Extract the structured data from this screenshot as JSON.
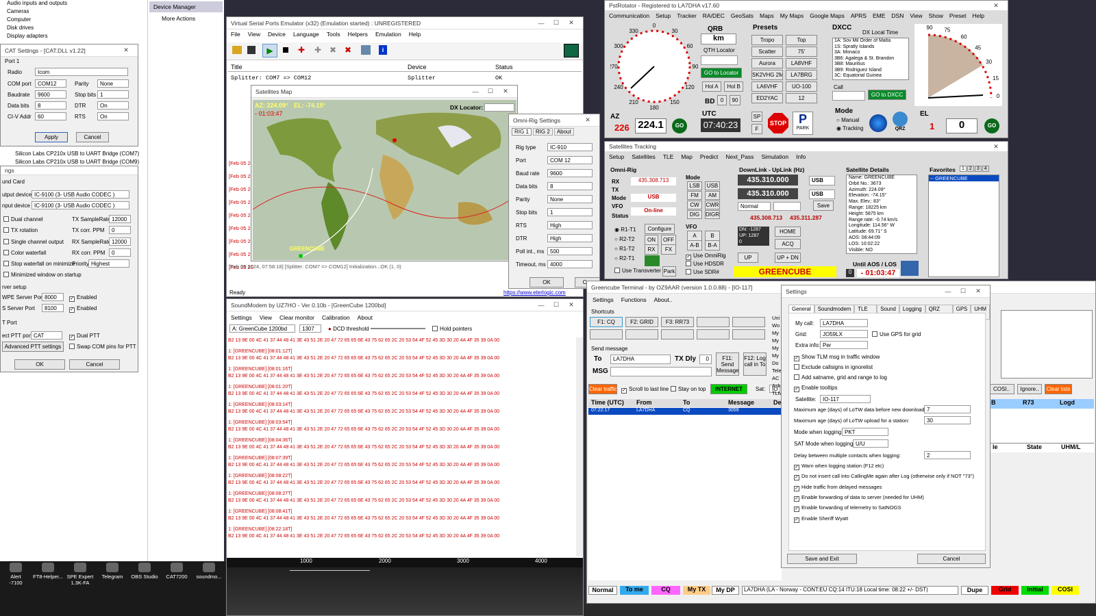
{
  "devmgr": {
    "items": [
      "Audio inputs and outputs",
      "Cameras",
      "Computer",
      "Disk drives",
      "Display adapters"
    ],
    "usb1": "Silicon Labs CP210x USB to UART Bridge (COM7)",
    "usb2": "Silicon Labs CP210x USB to UART Bridge (COM9)",
    "panel_title": "Device Manager",
    "more_actions": "More Actions"
  },
  "cat": {
    "title": "CAT Settings - [CAT.DLL v1.22]",
    "group": "Port 1",
    "radio_lbl": "Radio",
    "radio": "Icom",
    "com_lbl": "COM port",
    "com": "COM12",
    "parity_lbl": "Parity",
    "parity": "None",
    "baud_lbl": "Baudrate",
    "baud": "9600",
    "stop_lbl": "Stop bits",
    "stop": "1",
    "data_lbl": "Data bits",
    "data": "8",
    "dtr_lbl": "DTR",
    "dtr": "On",
    "civ_lbl": "CI-V Addr",
    "civ": "60",
    "rts_lbl": "RTS",
    "rts": "On",
    "apply": "Apply",
    "cancel": "Cancel"
  },
  "ss": {
    "title": "ngs",
    "group": "und Card",
    "out_lbl": "utput device",
    "out": "IC-9100 (3- USB Audio CODEC )",
    "in_lbl": "nput device",
    "in": "IC-9100 (3- USB Audio CODEC )",
    "dual": "Dual channel",
    "txsr_lbl": "TX SampleRate",
    "txsr": "12000",
    "txrot": "TX rotation",
    "txppm_lbl": "TX corr. PPM",
    "txppm": "0",
    "single": "Single channel output",
    "rxsr_lbl": "RX SampleRate",
    "rxsr": "12000",
    "color": "Color waterfall",
    "rxppm_lbl": "RX corr. PPM",
    "rxppm": "0",
    "stopwf": "Stop waterfall on minimize",
    "prio_lbl": "Priority",
    "prio": "Highest",
    "minwin": "Minimized window on startup",
    "srv": "rver setup",
    "agwpe_lbl": "WPE Server Port",
    "agwpe": "8000",
    "kiss_lbl": "S Server Port",
    "kiss": "8100",
    "enabled": "Enabled",
    "ptt": "T Port",
    "pttport_lbl": "ect PTT port",
    "pttport": "CAT",
    "dualptt": "Dual PTT",
    "swap": "Swap COM pins for PTT",
    "adv": "Advanced PTT settings",
    "ok": "OK",
    "cancel": "Cancel"
  },
  "vspe": {
    "title": "Virtual Serial Ports Emulator (x32) (Emulation started) : UNREGISTERED",
    "menu": [
      "File",
      "View",
      "Device",
      "Language",
      "Tools",
      "Helpers",
      "Emulation",
      "Help"
    ],
    "cols": [
      "Title",
      "Device",
      "Status"
    ],
    "row": {
      "title": "Splitter: COM7 => COM12",
      "device": "Splitter",
      "status": "OK"
    },
    "log": "[Feb 05 2024, 07:58:18] [Splitter: COM7 => COM12] Initialization...OK (1, 0)",
    "ready": "Ready",
    "link": "https://www.eterlogic.com",
    "dates": [
      "[Feb 05 20",
      "[Feb 05 20",
      "[Feb 05 20",
      "[Feb 05 20",
      "[Feb 05 20",
      "[Feb 05 20",
      "[Feb 05 20",
      "[Feb 05 20",
      "[Feb 05 20"
    ]
  },
  "satmap": {
    "title": "Satellites Map",
    "az": "AZ: 224.09°",
    "el": "EL: -74.15°",
    "time": "- 01:03:47",
    "dx": "DX Locator:",
    "sat": "GREENCUBE"
  },
  "omni": {
    "title": "Omni-Rig Settings",
    "tabs": [
      "RIG 1",
      "RIG 2",
      "About"
    ],
    "fields": [
      {
        "l": "Rig type",
        "v": "IC-910"
      },
      {
        "l": "Port",
        "v": "COM 12"
      },
      {
        "l": "Baud rate",
        "v": "9600"
      },
      {
        "l": "Data bits",
        "v": "8"
      },
      {
        "l": "Parity",
        "v": "None"
      },
      {
        "l": "Stop bits",
        "v": "1"
      },
      {
        "l": "RTS",
        "v": "High"
      },
      {
        "l": "DTR",
        "v": "High"
      },
      {
        "l": "Poll int., ms",
        "v": "500"
      },
      {
        "l": "Timeout, ms",
        "v": "4000"
      }
    ],
    "ok": "OK",
    "cancel": "Can"
  },
  "sm": {
    "title": "SoundModem by UZ7HO - Ver 0.10b - [GreenCube 1200bd]",
    "menu": [
      "Settings",
      "View",
      "Clear monitor",
      "Calibration",
      "About"
    ],
    "mode": "A: GreenCube 1200bd",
    "freq": "1307",
    "dcd": "DCD threshold",
    "hold": "Hold pointers",
    "hex": "B2 13 9E 00 4C 41 37 44 48 41 3E 43 51 2E 20 47 72 65 65 6E 43 75 62 65 2C 20 53 54 4F 52 45 3D 30 20 4A 4F 35 39 0A 00",
    "frames": [
      "1: [GREENCUBE] [08:01:12T]",
      "1: [GREENCUBE] [08:01:16T]",
      "1: [GREENCUBE] [08:01:20T]",
      "1: [GREENCUBE] [08:03:14T]",
      "1: [GREENCUBE] [08:03:54T]",
      "1: [GREENCUBE] [08:04:36T]",
      "1: [GREENCUBE] [08:07:39T]",
      "1: [GREENCUBE] [08:08:22T]",
      "1: [GREENCUBE] [08:08:27T]",
      "1: [GREENCUBE] [08:08:41T]",
      "1: [GREENCUBE] [08:22:18T]"
    ],
    "ticks": [
      "1000",
      "2000",
      "3000",
      "4000"
    ]
  },
  "pst": {
    "title": "PstRotator - Registered to LA7DHA  v17.60",
    "menu": [
      "Communication",
      "Setup",
      "Tracker",
      "RA/DEC",
      "GeoSats",
      "Maps",
      "My Maps",
      "Google Maps",
      "APRS",
      "EME",
      "DSN",
      "View",
      "Show",
      "Preset",
      "Help"
    ],
    "az_lbl": "AZ",
    "az_set": "226",
    "az": "224.1",
    "el_lbl": "EL",
    "el_set": "1",
    "el": "0",
    "go": "GO",
    "qrb": "QRB",
    "km": "km",
    "qthloc": "QTH Locator",
    "golocator": "GO to Locator",
    "hola": "Hol A",
    "holb": "Hol B",
    "bd": "BD",
    "bd0": "0",
    "bd90": "90",
    "utc_lbl": "UTC",
    "utc": "07:40:23",
    "presets": "Presets",
    "preset_btns": [
      "Tropo",
      "Top",
      "Scatter",
      "75'",
      "Aurora",
      "LA8VHF",
      "SK2VHG 2M",
      "LA7BRG",
      "LA6VHF",
      "UO-100",
      "ED2YAC",
      "12"
    ],
    "dxcc": "DXCC",
    "dxtime": "DX Local Time",
    "dxlist": [
      "1A:  Sov Mil Order of Malta",
      "1S:  Spratly Islands",
      "3A:  Monaco",
      "3B6:  Agalega & St. Brandon",
      "3B8:  Mauritius",
      "3B9:  Rodriguez Island",
      "3C:  Equatorial Guinea"
    ],
    "call": "Call",
    "godxcc": "GO to DXCC",
    "mode": "Mode",
    "manual": "Manual",
    "tracking": "Tracking",
    "stop": "STOP",
    "park": "PARK",
    "qrz": "QRZ",
    "sp": "SP",
    "f": "F",
    "dial": [
      "0",
      "30",
      "60",
      "90",
      "120",
      "150",
      "180",
      "210",
      "240",
      "270",
      "300",
      "330"
    ],
    "eldial": [
      "90",
      "75",
      "60",
      "45",
      "30",
      "15",
      "0"
    ]
  },
  "track": {
    "title": "Satellites Tracking",
    "menu": [
      "Setup",
      "Satellites",
      "TLE",
      "Map",
      "Predict",
      "Next_Pass",
      "Simulation",
      "Info"
    ],
    "omni": "Omni-Rig",
    "rx_lbl": "RX",
    "rx": "435.308.713",
    "tx_lbl": "TX",
    "mode_lbl": "Mode",
    "mode": "USB",
    "vfo_lbl": "VFO",
    "status_lbl": "Status",
    "status": "On-line",
    "rigs": [
      "R1-T1",
      "R2-T2",
      "R1-T2",
      "R2-T1"
    ],
    "modes_lbl": "Mode",
    "modes": [
      "LSB",
      "USB",
      "FM",
      "AM",
      "CW",
      "CWR",
      "DIG",
      "DIGR"
    ],
    "configure": "Configure",
    "on": "ON",
    "off": "OFF",
    "rxb": "RX",
    "txb": "TX",
    "fx": "FX",
    "vfo": "VFO",
    "vfoa": "A",
    "vfob": "B",
    "ab": "A-B",
    "ba": "B-A",
    "omnirig": "Use OmniRig",
    "hdsdr": "Use HDSDR",
    "sdr": "Use SDR#",
    "transv": "Use Transverter",
    "park": "Park",
    "dl": "DownLink - UpLink (Hz)",
    "f1": "435.310.000",
    "f2": "435.310.000",
    "usb": "USB",
    "normal": "Normal",
    "save": "Save",
    "dn": "DN: -1287",
    "up": "UP: 1287",
    "zero": "0",
    "fd1": "435.308.713",
    "fd2": "435.311.287",
    "home": "HOME",
    "acq": "ACQ",
    "upb": "UP",
    "updn": "UP + DN",
    "satname": "GREENCUBE",
    "details_lbl": "Satellite Details",
    "details": [
      "Name: GREENCUBE",
      "Orbit No.: 3673",
      "Azimuth: 224.09°",
      "Elevation: -74.15°",
      "Max. Elev.: 83°",
      "Range: 18225 km",
      "Height: 5875 km",
      "Range rate: -0.74 km/s",
      "Longitude: 114.56° W",
      "Latitude: 69.71° S",
      "AOS: 08:44:09",
      "LOS: 10:02:22",
      "Visible: NO"
    ],
    "aos": "Until AOS / LOS",
    "aosn": "0",
    "countdown": "- 01:03:47",
    "fav": "Favorites",
    "favtabs": [
      "1",
      "2",
      "3",
      "4"
    ],
    "favsel": "-- GREENCUBE"
  },
  "gt": {
    "title": "Greencube Terminal - by OZ9AAR (version 1.0.0.88) - [IO-117]",
    "menu": [
      "Settings",
      "Functions",
      "About.."
    ],
    "shortcuts": "Shortcuts",
    "sc": [
      "F1: CQ",
      "F2: GRID",
      "F3: RR73"
    ],
    "send": "Send message",
    "to_lbl": "To",
    "to": "LA7DHA",
    "txdly": "TX Dly",
    "txdlyv": "0",
    "msg_lbl": "MSG",
    "f11": "F11: Send Message",
    "f12": "F12: Log call in To",
    "clear": "Clear traffic",
    "scroll": "Scroll to last line",
    "top": "Stay on top",
    "internet": "INTERNET",
    "sat": "Sat:",
    "sat_v": "IO",
    "cols": [
      "Time (UTC)",
      "From",
      "To",
      "Message",
      "De"
    ],
    "row": [
      "07:22:17",
      "LA7DHA",
      "CQ",
      "3059",
      ""
    ],
    "side": [
      "Uni",
      "Wo",
      "My",
      "My",
      "My",
      "My",
      "Do",
      "Tele",
      "AC",
      "Ask",
      "TLM"
    ],
    "bottom": [
      "Normal",
      "To me",
      "CQ",
      "My TX",
      "My DP"
    ],
    "status": "LA7DHA (LA - Norway - CONT:EU CQ:14 ITU:18 Local time: 08:22 +/- DST)",
    "dupe": "Dupe",
    "grid": "Grid",
    "initial": "Initial",
    "cosi": "COSI",
    "right": [
      "COSI..",
      "Ignore..",
      "Clear lists"
    ],
    "rcols": [
      "B",
      "R73",
      "Logd"
    ],
    "rcols2": [
      "le",
      "State",
      "UHM/L"
    ]
  },
  "gs": {
    "title": "Settings",
    "tabs": [
      "General",
      "Soundmodem",
      "TLE data",
      "Sound",
      "Logging",
      "QRZ lookup",
      "GPS",
      "UHM"
    ],
    "mycall_lbl": "My call:",
    "mycall": "LA7DHA",
    "grid_lbl": "Grid:",
    "grid": "JO59LX",
    "gps": "Use GPS for grid",
    "extra_lbl": "Extra info:",
    "extra": "Per",
    "checks1": [
      "Show TLM msg in traffic window",
      "Exclude callsigns in ignorelist",
      "Add satname, grid and range to log",
      "Enable tooltips"
    ],
    "sat_lbl": "Satellite:",
    "sat": "IO-117",
    "lotw1": "Maximum age (days) of LoTW data before new download:",
    "lotw1v": "7",
    "lotw2": "Maximum age (days) of LoTW upload for a station:",
    "lotw2v": "30",
    "mode_lbl": "Mode when logging:",
    "mode": "PKT",
    "satmode_lbl": "SAT Mode when logging:",
    "satmode": "U/U",
    "delay_lbl": "Delay between multiple contacts when logging:",
    "delay": "2",
    "checks2": [
      "Warn when logging station (F12 etc)",
      "Do not insert call into CallingMe again after Log (otherwise only if NOT \"73\")",
      "Hide traffic from delayed messages",
      "Enable forwarding of data to server (needed for UHM)",
      "Enable forwarding of telemetry to SatNOGS",
      "Enable Sheriff Wyatt"
    ],
    "save": "Save and Exit",
    "cancel": "Cancel"
  },
  "taskbar": [
    {
      "l": "Alert\n-7100"
    },
    {
      "l": "FT8-Helper..."
    },
    {
      "l": "SPE Expert\n1.3K-FA"
    },
    {
      "l": "Telegram"
    },
    {
      "l": "OBS Studio"
    },
    {
      "l": "CAT7200"
    },
    {
      "l": "soundmo..."
    }
  ]
}
